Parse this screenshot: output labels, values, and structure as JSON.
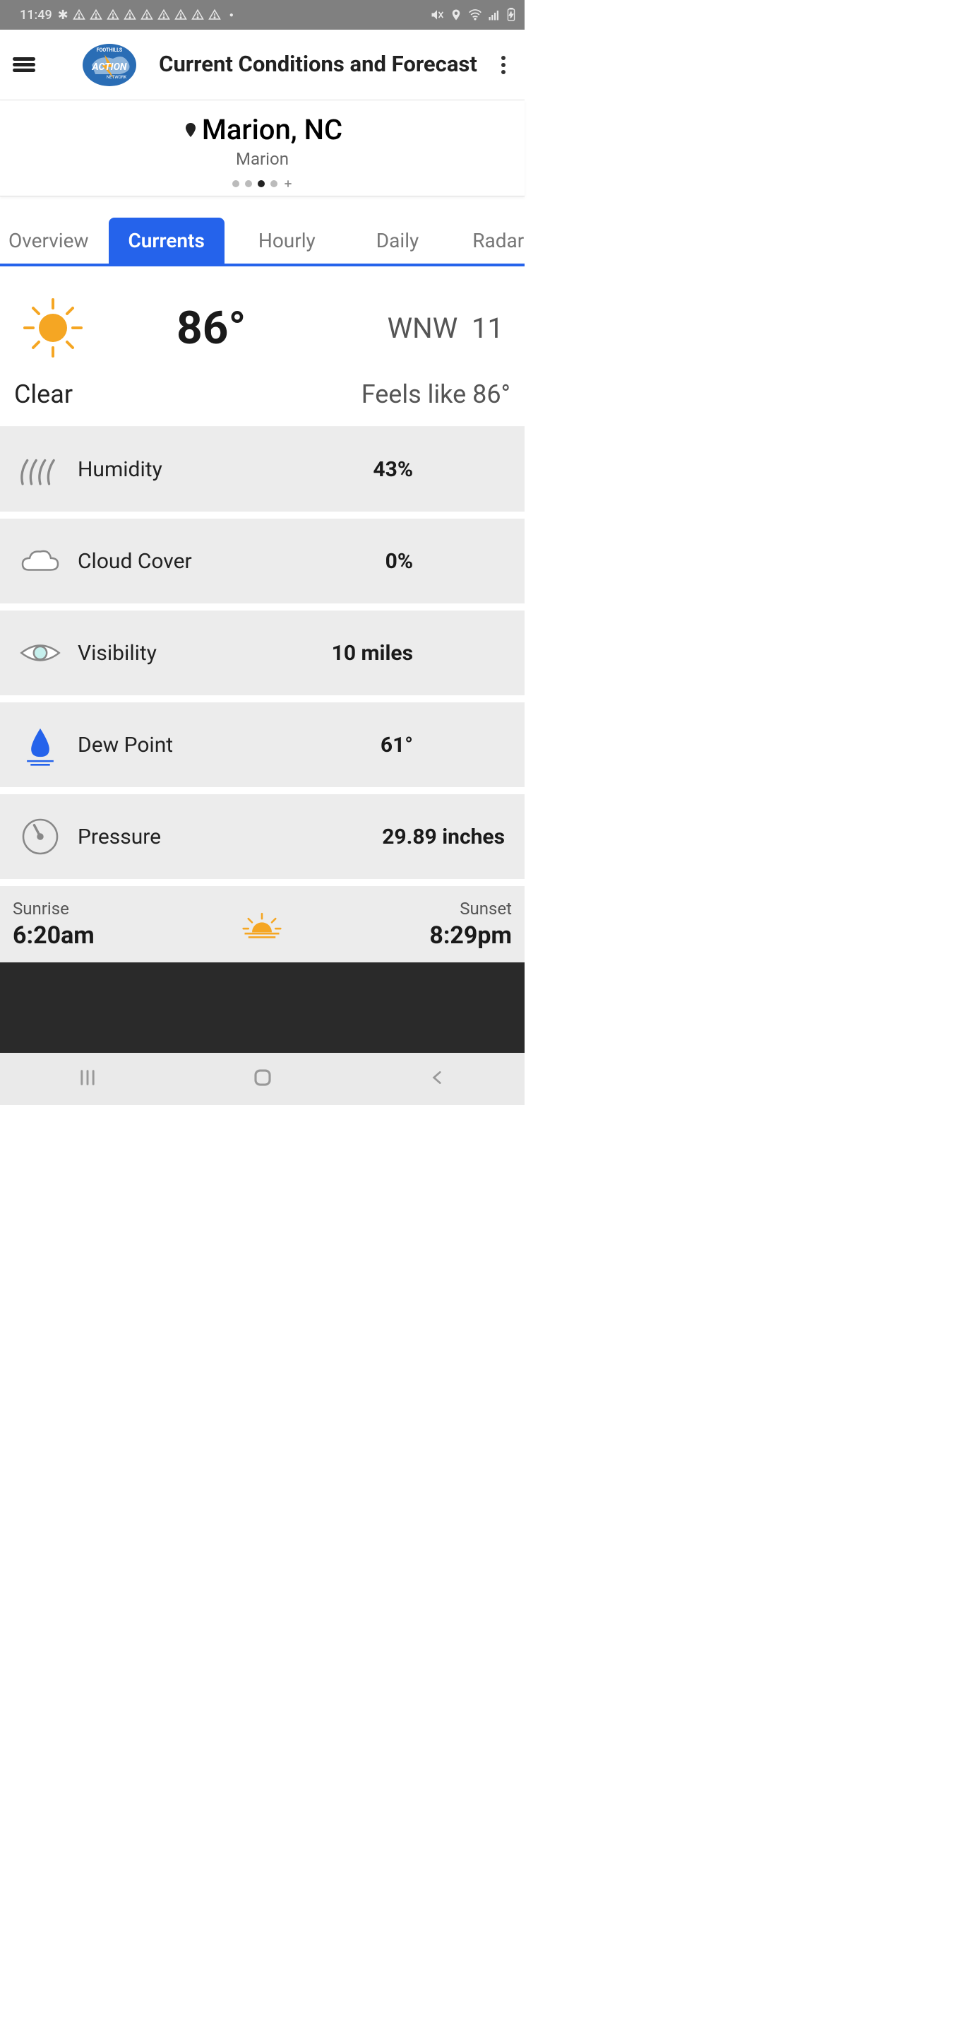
{
  "status": {
    "time": "11:49"
  },
  "header": {
    "title": "Current Conditions and Forecast"
  },
  "location": {
    "city": "Marion, NC",
    "sub": "Marion"
  },
  "tabs": [
    {
      "label": "Overview"
    },
    {
      "label": "Currents"
    },
    {
      "label": "Hourly"
    },
    {
      "label": "Daily"
    },
    {
      "label": "Radar"
    }
  ],
  "current": {
    "temp": "86°",
    "wind_dir": "WNW",
    "wind_speed": "11",
    "condition": "Clear",
    "feels_like": "Feels like 86°"
  },
  "details": [
    {
      "label": "Humidity",
      "value": "43%",
      "icon": "humidity"
    },
    {
      "label": "Cloud Cover",
      "value": "0%",
      "icon": "cloud"
    },
    {
      "label": "Visibility",
      "value": "10 miles",
      "icon": "eye"
    },
    {
      "label": "Dew Point",
      "value": "61°",
      "icon": "dew"
    },
    {
      "label": "Pressure",
      "value": "29.89 inches",
      "icon": "pressure"
    }
  ],
  "sun": {
    "sunrise_label": "Sunrise",
    "sunrise": "6:20am",
    "sunset_label": "Sunset",
    "sunset": "8:29pm"
  }
}
